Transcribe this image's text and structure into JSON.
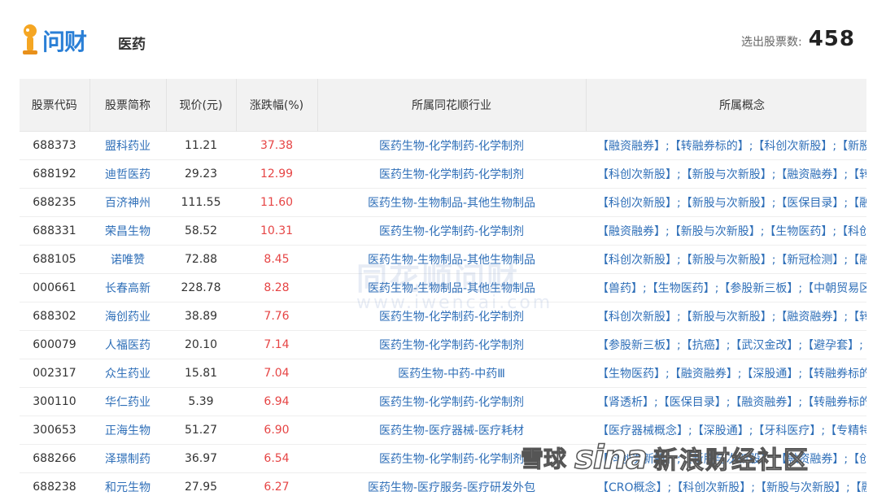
{
  "header": {
    "logo_text": "问财",
    "page_title": "医药",
    "count_label": "选出股票数:",
    "count_value": "458"
  },
  "table": {
    "columns": [
      "股票代码",
      "股票简称",
      "现价(元)",
      "涨跌幅(%)",
      "所属同花顺行业",
      "所属概念"
    ],
    "rows": [
      {
        "code": "688373",
        "name": "盟科药业",
        "price": "11.21",
        "change": "37.38",
        "industry": "医药生物-化学制药-化学制剂",
        "concepts": "【融资融券】;【转融券标的】;【科创次新股】;【新股"
      },
      {
        "code": "688192",
        "name": "迪哲医药",
        "price": "29.23",
        "change": "12.99",
        "industry": "医药生物-化学制药-化学制剂",
        "concepts": "【科创次新股】;【新股与次新股】;【融资融券】;【转"
      },
      {
        "code": "688235",
        "name": "百济神州",
        "price": "111.55",
        "change": "11.60",
        "industry": "医药生物-生物制品-其他生物制品",
        "concepts": "【科创次新股】;【新股与次新股】;【医保目录】;【融"
      },
      {
        "code": "688331",
        "name": "荣昌生物",
        "price": "58.52",
        "change": "10.31",
        "industry": "医药生物-化学制药-化学制剂",
        "concepts": "【融资融券】;【新股与次新股】;【生物医药】;【科创"
      },
      {
        "code": "688105",
        "name": "诺唯赞",
        "price": "72.88",
        "change": "8.45",
        "industry": "医药生物-生物制品-其他生物制品",
        "concepts": "【科创次新股】;【新股与次新股】;【新冠检测】;【融"
      },
      {
        "code": "000661",
        "name": "长春高新",
        "price": "228.78",
        "change": "8.28",
        "industry": "医药生物-生物制品-其他生物制品",
        "concepts": "【兽药】;【生物医药】;【参股新三板】;【中朝贸易区"
      },
      {
        "code": "688302",
        "name": "海创药业",
        "price": "38.89",
        "change": "7.76",
        "industry": "医药生物-化学制药-化学制剂",
        "concepts": "【科创次新股】;【新股与次新股】;【融资融券】;【转"
      },
      {
        "code": "600079",
        "name": "人福医药",
        "price": "20.10",
        "change": "7.14",
        "industry": "医药生物-化学制药-化学制剂",
        "concepts": "【参股新三板】;【抗癌】;【武汉金改】;【避孕套】;【"
      },
      {
        "code": "002317",
        "name": "众生药业",
        "price": "15.81",
        "change": "7.04",
        "industry": "医药生物-中药-中药Ⅲ",
        "concepts": "【生物医药】;【融资融券】;【深股通】;【转融券标的"
      },
      {
        "code": "300110",
        "name": "华仁药业",
        "price": "5.39",
        "change": "6.94",
        "industry": "医药生物-化学制药-化学制剂",
        "concepts": "【肾透析】;【医保目录】;【融资融券】;【转融券标的"
      },
      {
        "code": "300653",
        "name": "正海生物",
        "price": "51.27",
        "change": "6.90",
        "industry": "医药生物-医疗器械-医疗耗材",
        "concepts": "【医疗器械概念】;【深股通】;【牙科医疗】;【专精特"
      },
      {
        "code": "688266",
        "name": "泽璟制药",
        "price": "36.97",
        "change": "6.54",
        "industry": "医药生物-化学制药-化学制剂",
        "concepts": "【科创次新股】;【新股与次新股】;【融资融券】;【创新药"
      },
      {
        "code": "688238",
        "name": "和元生物",
        "price": "27.95",
        "change": "6.27",
        "industry": "医药生物-医疗服务-医疗研发外包",
        "concepts": "【CRO概念】;【科创次新股】;【新股与次新股】;【融"
      }
    ]
  },
  "watermark": {
    "line1": "同花顺问财",
    "line2": "www.iwencai.com"
  },
  "overlay": {
    "xueqiu": "雪球",
    "sina_logo": "sina",
    "sina_text": "新浪财经社区"
  },
  "colors": {
    "accent_blue": "#2f6fb8",
    "rise_red": "#e64545",
    "header_bg": "#f2f2f2",
    "logo_orange": "#f5a623"
  }
}
